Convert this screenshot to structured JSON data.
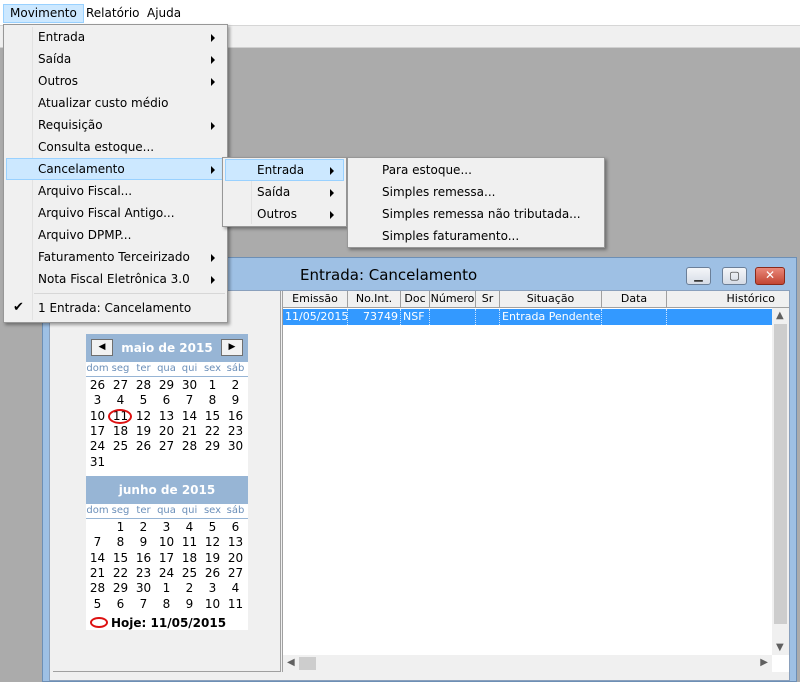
{
  "menubar": {
    "items": [
      "Movimento",
      "Relatório",
      "Ajuda"
    ]
  },
  "main_menu": {
    "items": [
      "Entrada",
      "Saída",
      "Outros",
      "Atualizar custo médio",
      "Requisição",
      "Consulta estoque...",
      "Cancelamento",
      "Arquivo Fiscal...",
      "Arquivo Fiscal Antigo...",
      "Arquivo DPMP...",
      "Faturamento Terceirizado",
      "Nota Fiscal Eletrônica 3.0"
    ],
    "window_item": "1 Entrada: Cancelamento",
    "check_glyph": "✔"
  },
  "sub_menu": {
    "items": [
      "Entrada",
      "Saída",
      "Outros"
    ]
  },
  "sub_sub_menu": {
    "items": [
      "Para estoque...",
      "Simples remessa...",
      "Simples remessa não tributada...",
      "Simples faturamento..."
    ]
  },
  "child_window": {
    "title": "Entrada: Cancelamento",
    "btn_minimize": "▁",
    "btn_maximize": "▢",
    "btn_close": "✕"
  },
  "calendar": {
    "prev_glyph": "◀",
    "next_glyph": "▶",
    "dow": [
      "dom",
      "seg",
      "ter",
      "qua",
      "qui",
      "sex",
      "sáb"
    ],
    "months": [
      {
        "title": "maio de 2015",
        "weeks": [
          [
            "26",
            "27",
            "28",
            "29",
            "30",
            "1",
            "2"
          ],
          [
            "3",
            "4",
            "5",
            "6",
            "7",
            "8",
            "9"
          ],
          [
            "10",
            "11",
            "12",
            "13",
            "14",
            "15",
            "16"
          ],
          [
            "17",
            "18",
            "19",
            "20",
            "21",
            "22",
            "23"
          ],
          [
            "24",
            "25",
            "26",
            "27",
            "28",
            "29",
            "30"
          ],
          [
            "31",
            "",
            "",
            "",
            "",
            "",
            ""
          ]
        ]
      },
      {
        "title": "junho de 2015",
        "weeks": [
          [
            "",
            "1",
            "2",
            "3",
            "4",
            "5",
            "6"
          ],
          [
            "7",
            "8",
            "9",
            "10",
            "11",
            "12",
            "13"
          ],
          [
            "14",
            "15",
            "16",
            "17",
            "18",
            "19",
            "20"
          ],
          [
            "21",
            "22",
            "23",
            "24",
            "25",
            "26",
            "27"
          ],
          [
            "28",
            "29",
            "30",
            "1",
            "2",
            "3",
            "4"
          ],
          [
            "5",
            "6",
            "7",
            "8",
            "9",
            "10",
            "11"
          ]
        ]
      }
    ],
    "today_label": "Hoje: 11/05/2015"
  },
  "grid": {
    "columns": [
      "Emissão",
      "No.Int.",
      "Doc",
      "Número",
      "Sr",
      "Situação",
      "Data",
      "Histórico"
    ],
    "rows": [
      [
        "11/05/2015",
        "73749",
        "NSF",
        "",
        "",
        "Entrada Pendente",
        "",
        ""
      ]
    ],
    "scroll_up": "▲",
    "scroll_down": "▼",
    "scroll_left": "◀",
    "scroll_right": "▶"
  }
}
